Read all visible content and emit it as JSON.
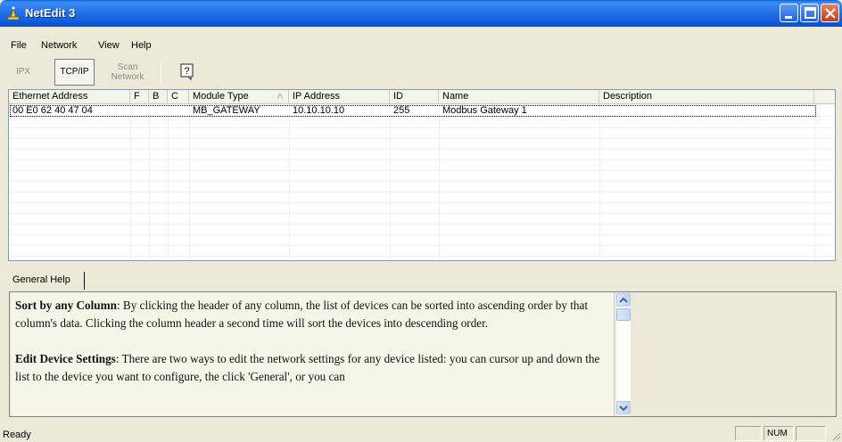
{
  "window": {
    "title": "NetEdit 3"
  },
  "menu": [
    "File",
    "Network",
    "View",
    "Help"
  ],
  "toolbar": {
    "ipx": "IPX",
    "tcpip": "TCP/IP",
    "scan_line1": "Scan",
    "scan_line2": "Network"
  },
  "grid": {
    "columns": [
      "Ethernet Address",
      "F",
      "B",
      "C",
      "Module Type",
      "IP Address",
      "ID",
      "Name",
      "Description"
    ],
    "rows": [
      [
        "00 E0 62 40 47 04",
        "",
        "",
        "",
        "MB_GATEWAY",
        "10.10.10.10",
        "255",
        "Modbus Gateway 1",
        ""
      ]
    ]
  },
  "help": {
    "tab": "General Help",
    "para1_bold": "Sort by any Column",
    "para1_text": ": By clicking the header of any column, the list of devices can be sorted into ascending order by that column's data. Clicking the column header a second time will sort the devices into descending order.",
    "para2_bold": "Edit Device Settings",
    "para2_text": ": There are two ways to edit the network settings for any device listed: you can cursor up and down the list to the device you want to configure, the click 'General', or you can"
  },
  "status": {
    "text": "Ready",
    "num": "NUM"
  }
}
